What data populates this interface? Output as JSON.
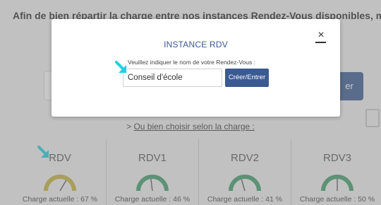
{
  "background": {
    "intro_text": "Afin de bien répartir la charge entre nos instances Rendez-Vous disponibles, merci d",
    "submit_fragment": "er",
    "alt_link_prefix": "> ",
    "alt_link": "Ou bien choisir selon la charge :"
  },
  "modal": {
    "title": "INSTANCE RDV",
    "close_label": "×",
    "label": "Veuillez indiquer le nom de votre Rendez-Vous :",
    "input_value": "Conseil d'école",
    "button_label": "Créer/Entrer"
  },
  "instances": [
    {
      "name": "RDV",
      "charge_text": "Charge actuelle : 67 %",
      "charge_percent": 67,
      "color": "#c9b43a"
    },
    {
      "name": "RDV1",
      "charge_text": "Charge actuelle : 46 %",
      "charge_percent": 46,
      "color": "#3f9e6a"
    },
    {
      "name": "RDV2",
      "charge_text": "Charge actuelle : 41 %",
      "charge_percent": 41,
      "color": "#3f9e6a"
    },
    {
      "name": "RDV3",
      "charge_text": "Charge actuelle : 50 %",
      "charge_percent": 50,
      "color": "#3f9e6a"
    }
  ],
  "colors": {
    "accent": "#3a5a92",
    "highlight_arrow": "#1fd0e0",
    "gauge_track": "#bbbbbb"
  }
}
